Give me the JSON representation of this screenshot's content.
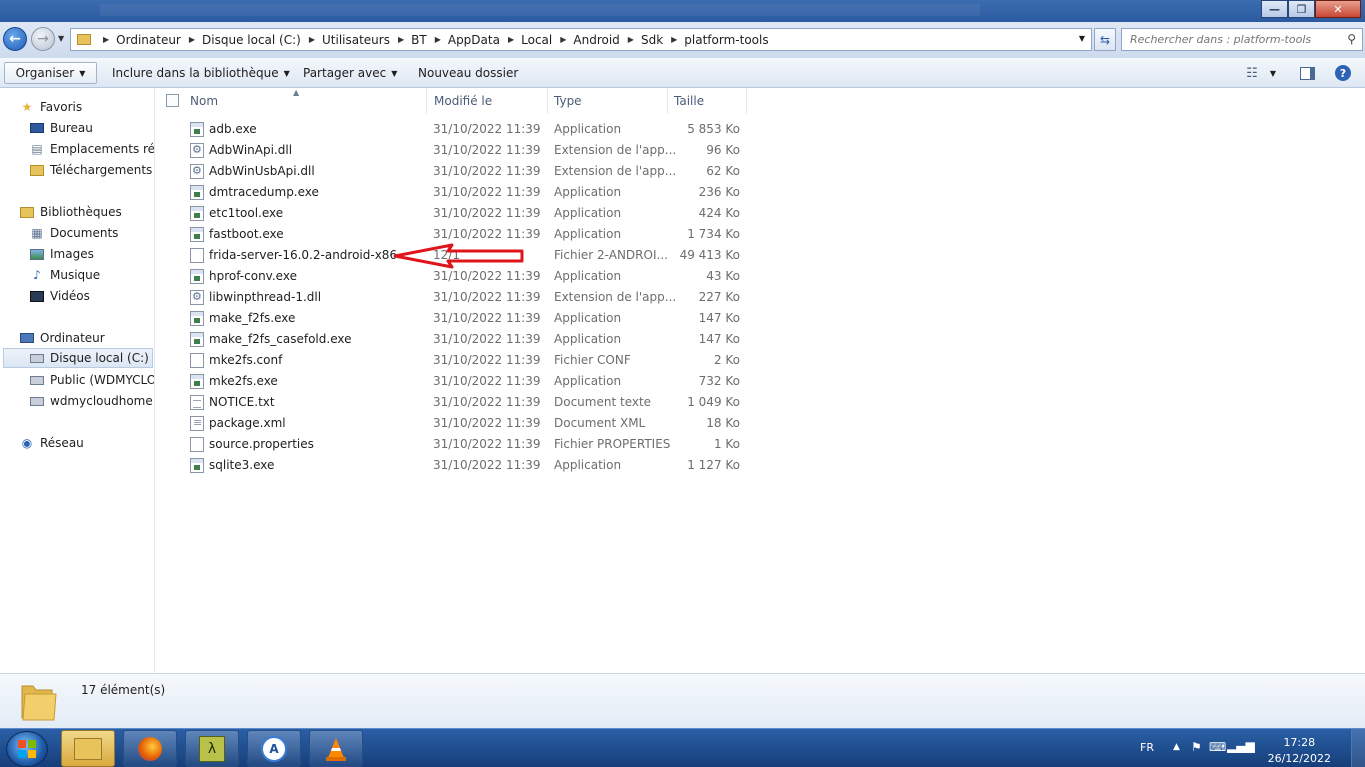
{
  "window": {
    "minimize_label": "—",
    "maximize_label": "❐",
    "close_label": "✕"
  },
  "address": {
    "crumbs": [
      "Ordinateur",
      "Disque local (C:)",
      "Utilisateurs",
      "BT",
      "AppData",
      "Local",
      "Android",
      "Sdk",
      "platform-tools"
    ],
    "search_placeholder": "Rechercher dans : platform-tools"
  },
  "toolbar": {
    "organiser": "Organiser",
    "inclure": "Inclure dans la bibliothèque",
    "partager": "Partager avec",
    "nouveau_dossier": "Nouveau dossier"
  },
  "nav": {
    "favoris": "Favoris",
    "bureau": "Bureau",
    "emplacements": "Emplacements réce",
    "telechargements": "Téléchargements",
    "bibliotheques": "Bibliothèques",
    "documents": "Documents",
    "images": "Images",
    "musique": "Musique",
    "videos": "Vidéos",
    "ordinateur": "Ordinateur",
    "disque_local": "Disque local (C:)",
    "public": "Public (WDMYCLOU",
    "wdmycloud": "wdmycloudhome.h",
    "reseau": "Réseau"
  },
  "columns": {
    "nom": "Nom",
    "modifie": "Modifié le",
    "type": "Type",
    "taille": "Taille"
  },
  "files": [
    {
      "name": "adb.exe",
      "date": "31/10/2022 11:39",
      "type": "Application",
      "size": "5 853 Ko",
      "icon": "exe-icon"
    },
    {
      "name": "AdbWinApi.dll",
      "date": "31/10/2022 11:39",
      "type": "Extension de l'app...",
      "size": "96 Ko",
      "icon": "dll-icon"
    },
    {
      "name": "AdbWinUsbApi.dll",
      "date": "31/10/2022 11:39",
      "type": "Extension de l'app...",
      "size": "62 Ko",
      "icon": "dll-icon"
    },
    {
      "name": "dmtracedump.exe",
      "date": "31/10/2022 11:39",
      "type": "Application",
      "size": "236 Ko",
      "icon": "exe-icon"
    },
    {
      "name": "etc1tool.exe",
      "date": "31/10/2022 11:39",
      "type": "Application",
      "size": "424 Ko",
      "icon": "exe-icon"
    },
    {
      "name": "fastboot.exe",
      "date": "31/10/2022 11:39",
      "type": "Application",
      "size": "1 734 Ko",
      "icon": "exe-icon"
    },
    {
      "name": "frida-server-16.0.2-android-x86",
      "date": "12/1",
      "type": "Fichier 2-ANDROI...",
      "size": "49 413 Ko",
      "icon": "file-icon"
    },
    {
      "name": "hprof-conv.exe",
      "date": "31/10/2022 11:39",
      "type": "Application",
      "size": "43 Ko",
      "icon": "exe-icon"
    },
    {
      "name": "libwinpthread-1.dll",
      "date": "31/10/2022 11:39",
      "type": "Extension de l'app...",
      "size": "227 Ko",
      "icon": "dll-icon"
    },
    {
      "name": "make_f2fs.exe",
      "date": "31/10/2022 11:39",
      "type": "Application",
      "size": "147 Ko",
      "icon": "exe-icon"
    },
    {
      "name": "make_f2fs_casefold.exe",
      "date": "31/10/2022 11:39",
      "type": "Application",
      "size": "147 Ko",
      "icon": "exe-icon"
    },
    {
      "name": "mke2fs.conf",
      "date": "31/10/2022 11:39",
      "type": "Fichier CONF",
      "size": "2 Ko",
      "icon": "file-icon"
    },
    {
      "name": "mke2fs.exe",
      "date": "31/10/2022 11:39",
      "type": "Application",
      "size": "732 Ko",
      "icon": "exe-icon"
    },
    {
      "name": "NOTICE.txt",
      "date": "31/10/2022 11:39",
      "type": "Document texte",
      "size": "1 049 Ko",
      "icon": "txt-icon"
    },
    {
      "name": "package.xml",
      "date": "31/10/2022 11:39",
      "type": "Document XML",
      "size": "18 Ko",
      "icon": "xml-icon"
    },
    {
      "name": "source.properties",
      "date": "31/10/2022 11:39",
      "type": "Fichier PROPERTIES",
      "size": "1 Ko",
      "icon": "file-icon"
    },
    {
      "name": "sqlite3.exe",
      "date": "31/10/2022 11:39",
      "type": "Application",
      "size": "1 127 Ko",
      "icon": "exe-icon"
    }
  ],
  "status": {
    "count": "17 élément(s)"
  },
  "taskbar": {
    "lang": "FR",
    "time": "17:28",
    "date": "26/12/2022"
  },
  "colors": {
    "annotation_arrow": "#e0141b",
    "taskbar": "#1f4f91",
    "selection": "#dbe6f4"
  }
}
